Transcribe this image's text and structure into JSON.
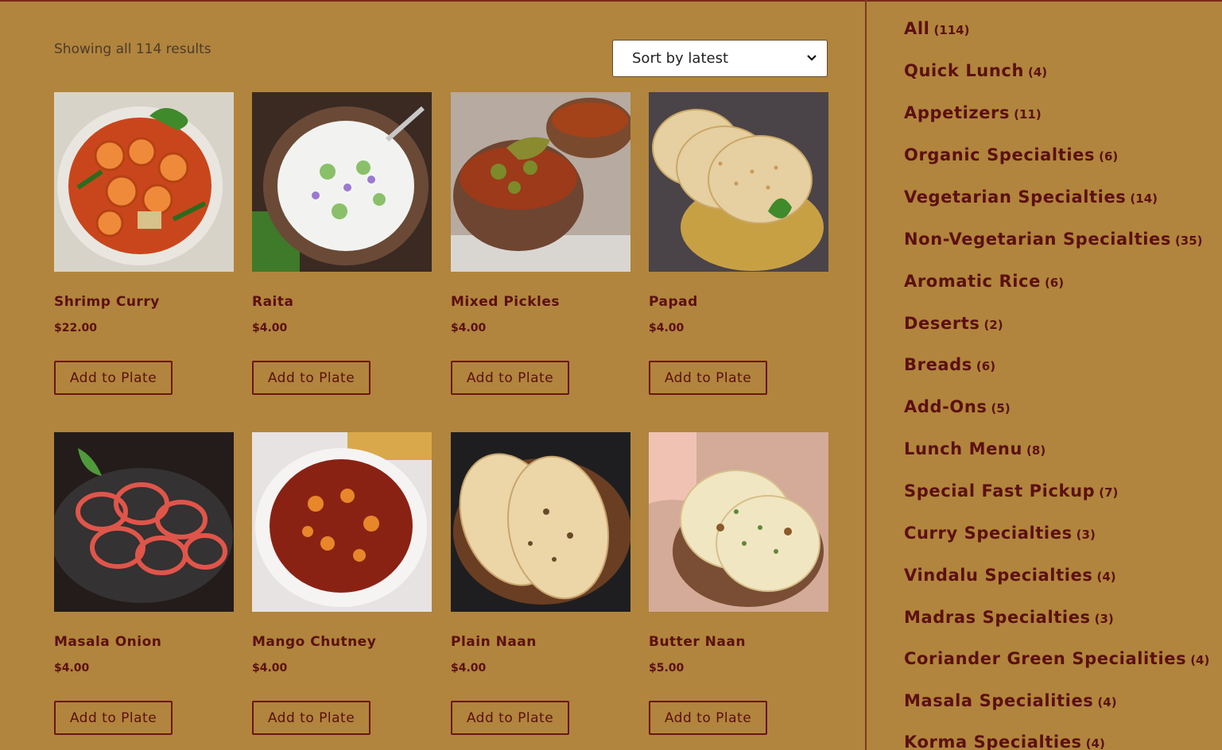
{
  "results_text": "Showing all 114 results",
  "sort": {
    "selected": "Sort by latest"
  },
  "products": [
    {
      "name": "Shrimp Curry",
      "price": "$22.00",
      "button": "Add to Plate",
      "image": "shrimp-curry-photo"
    },
    {
      "name": "Raita",
      "price": "$4.00",
      "button": "Add to Plate",
      "image": "raita-photo"
    },
    {
      "name": "Mixed Pickles",
      "price": "$4.00",
      "button": "Add to Plate",
      "image": "mixed-pickles-photo"
    },
    {
      "name": "Papad",
      "price": "$4.00",
      "button": "Add to Plate",
      "image": "papad-photo"
    },
    {
      "name": "Masala Onion",
      "price": "$4.00",
      "button": "Add to Plate",
      "image": "masala-onion-photo"
    },
    {
      "name": "Mango Chutney",
      "price": "$4.00",
      "button": "Add to Plate",
      "image": "mango-chutney-photo"
    },
    {
      "name": "Plain Naan",
      "price": "$4.00",
      "button": "Add to Plate",
      "image": "plain-naan-photo"
    },
    {
      "name": "Butter Naan",
      "price": "$5.00",
      "button": "Add to Plate",
      "image": "butter-naan-photo"
    }
  ],
  "categories": [
    {
      "label": "All",
      "count": "(114)"
    },
    {
      "label": "Quick Lunch",
      "count": "(4)"
    },
    {
      "label": "Appetizers",
      "count": "(11)"
    },
    {
      "label": "Organic Specialties",
      "count": "(6)"
    },
    {
      "label": "Vegetarian Specialties",
      "count": "(14)"
    },
    {
      "label": "Non-Vegetarian Specialties",
      "count": "(35)"
    },
    {
      "label": "Aromatic Rice",
      "count": "(6)"
    },
    {
      "label": "Deserts",
      "count": "(2)"
    },
    {
      "label": "Breads",
      "count": "(6)"
    },
    {
      "label": "Add-Ons",
      "count": "(5)"
    },
    {
      "label": "Lunch Menu",
      "count": "(8)"
    },
    {
      "label": "Special Fast Pickup",
      "count": "(7)"
    },
    {
      "label": "Curry Specialties",
      "count": "(3)"
    },
    {
      "label": "Vindalu Specialties",
      "count": "(4)"
    },
    {
      "label": "Madras Specialties",
      "count": "(3)"
    },
    {
      "label": "Coriander Green Specialities",
      "count": "(4)"
    },
    {
      "label": "Masala Specialities",
      "count": "(4)"
    },
    {
      "label": "Korma Specialties",
      "count": "(4)"
    }
  ],
  "colors": {
    "background": "#b1853d",
    "text": "#5c1010",
    "divider": "#7a3a1f"
  }
}
